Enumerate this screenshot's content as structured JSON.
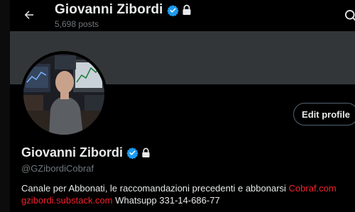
{
  "header": {
    "name": "Giovanni Zibordi",
    "posts": "5,698 posts",
    "back_icon": "arrow-left-icon",
    "search_icon": "search-icon"
  },
  "profile": {
    "name": "Giovanni Zibordi",
    "handle": "@GZibordiCobraf",
    "edit_button": "Edit profile",
    "bio": {
      "text1": "Canale per Abbonati,  le raccomandazioni precedenti e abbonarsi ",
      "link1": "Cobraf.com",
      "link2": "gzibordi.substack.com",
      "text2": " Whatsupp 331-14-686-77"
    }
  },
  "colors": {
    "verified": "#1d9bf0",
    "link": "#f4212e",
    "banner": "#333639",
    "muted": "#71767b"
  }
}
